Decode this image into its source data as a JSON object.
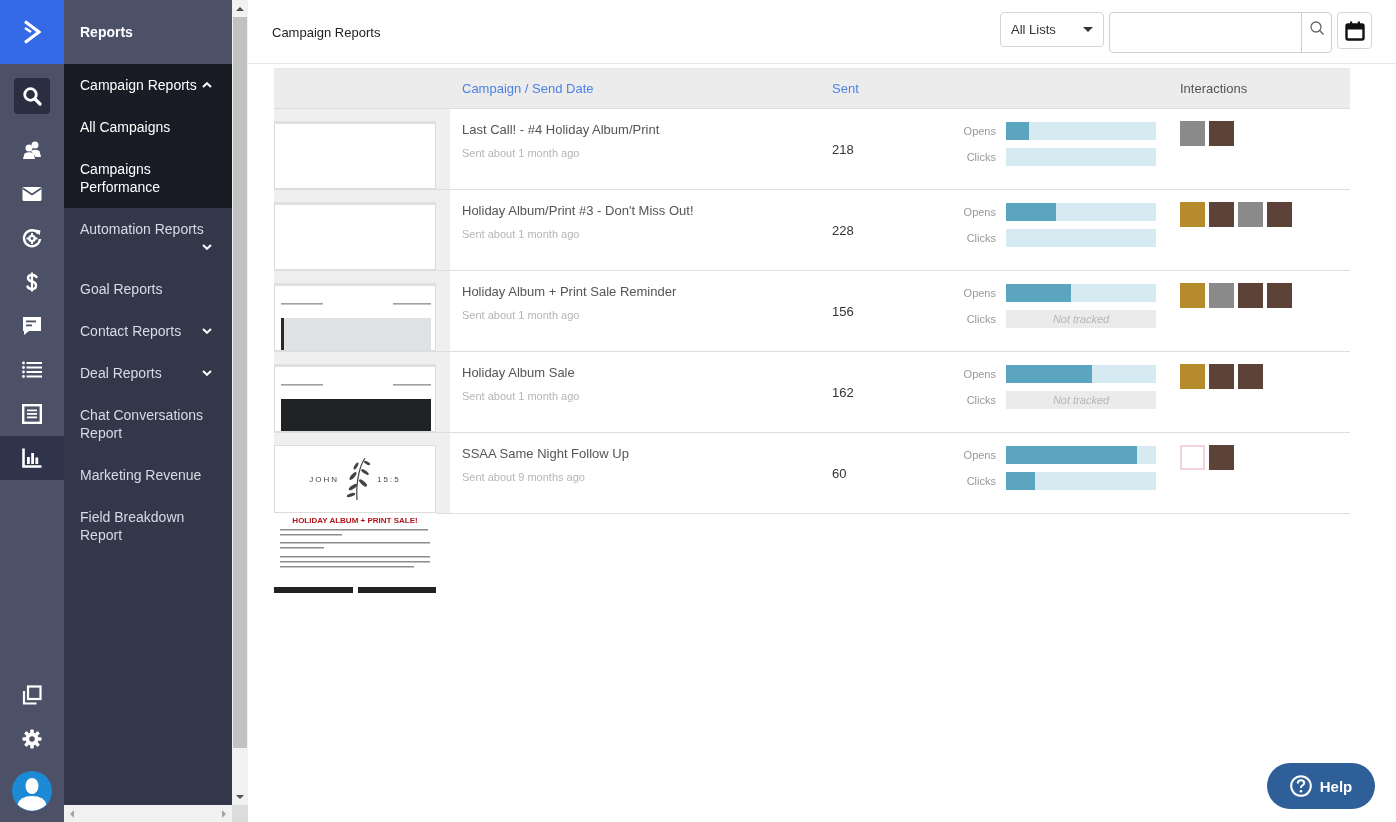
{
  "rail": {
    "items": [
      {
        "selected": false
      },
      {
        "selected": false
      },
      {
        "selected": false
      },
      {
        "selected": false
      },
      {
        "selected": false
      },
      {
        "selected": false
      },
      {
        "selected": false
      },
      {
        "selected": true
      }
    ]
  },
  "nav": {
    "title": "Reports",
    "items": [
      {
        "label": "Campaign Reports",
        "kind": "group",
        "expanded": true,
        "children": [
          {
            "label": "All Campaigns"
          },
          {
            "label": "Campaigns Performance"
          }
        ]
      },
      {
        "label": "Automation Reports",
        "kind": "group",
        "expanded": false
      },
      {
        "label": "Goal Reports",
        "kind": "link",
        "expanded": false
      },
      {
        "label": "Contact Reports",
        "kind": "group",
        "expanded": false
      },
      {
        "label": "Deal Reports",
        "kind": "group",
        "expanded": false
      },
      {
        "label": "Chat Conversations Report",
        "kind": "link",
        "expanded": false
      },
      {
        "label": "Marketing Revenue",
        "kind": "link",
        "expanded": false
      },
      {
        "label": "Field Breakdown Report",
        "kind": "link",
        "expanded": false
      }
    ]
  },
  "header": {
    "title": "Campaign Reports",
    "list_filter": "All Lists"
  },
  "table": {
    "columns": [
      {
        "label": "Campaign / Send Date",
        "sortable": true
      },
      {
        "label": "Sent",
        "sortable": true
      },
      {
        "label": "Interactions",
        "sortable": false
      }
    ],
    "rows": [
      {
        "thumbnail": {
          "kind": "blank"
        },
        "name": "Last Call! - #4 Holiday Album/Print",
        "sent_date": "Sent about 1 month ago",
        "sent": "218",
        "metrics": [
          {
            "label": "Opens",
            "tracked": true,
            "level": 0.15
          },
          {
            "label": "Clicks",
            "tracked": true
          }
        ],
        "interactions": [
          {
            "kind": "mono"
          },
          {
            "kind": "portrait"
          }
        ]
      },
      {
        "thumbnail": {
          "kind": "blank"
        },
        "name": "Holiday Album/Print #3 - Don't Miss Out!",
        "sent_date": "Sent about 1 month ago",
        "sent": "228",
        "metrics": [
          {
            "label": "Opens",
            "tracked": true,
            "level": 0.33
          },
          {
            "label": "Clicks",
            "tracked": true
          }
        ],
        "interactions": [
          {
            "kind": "landscape"
          },
          {
            "kind": "portrait"
          },
          {
            "kind": "mono"
          },
          {
            "kind": "portrait"
          }
        ]
      },
      {
        "thumbnail": {
          "kind": "gallery"
        },
        "name": "Holiday Album + Print Sale Reminder",
        "sent_date": "Sent about 1 month ago",
        "sent": "156",
        "metrics": [
          {
            "label": "Opens",
            "tracked": true,
            "level": 0.43
          },
          {
            "label": "Clicks",
            "tracked": false,
            "note": "Not tracked"
          }
        ],
        "interactions": [
          {
            "kind": "landscape"
          },
          {
            "kind": "mono"
          },
          {
            "kind": "portrait"
          },
          {
            "kind": "portrait"
          }
        ]
      },
      {
        "thumbnail": {
          "kind": "album"
        },
        "name": "Holiday Album Sale",
        "sent_date": "Sent about 1 month ago",
        "sent": "162",
        "metrics": [
          {
            "label": "Opens",
            "tracked": true,
            "level": 0.57
          },
          {
            "label": "Clicks",
            "tracked": false,
            "note": "Not tracked"
          }
        ],
        "interactions": [
          {
            "kind": "landscape"
          },
          {
            "kind": "portrait"
          },
          {
            "kind": "portrait"
          }
        ]
      },
      {
        "thumbnail": {
          "kind": "poster",
          "logo_words": [
            "JOHN",
            "15:5"
          ],
          "headline": "HOLIDAY ALBUM + PRINT SALE!"
        },
        "name": "SSAA Same Night Follow Up",
        "sent_date": "Sent about 9 months ago",
        "sent": "60",
        "metrics": [
          {
            "label": "Opens",
            "tracked": true,
            "level": 0.87
          },
          {
            "label": "Clicks",
            "tracked": true,
            "level": 0.19
          }
        ],
        "interactions": [
          {
            "kind": "logo"
          },
          {
            "kind": "portrait"
          }
        ]
      }
    ]
  },
  "help_button": {
    "label": "Help"
  }
}
